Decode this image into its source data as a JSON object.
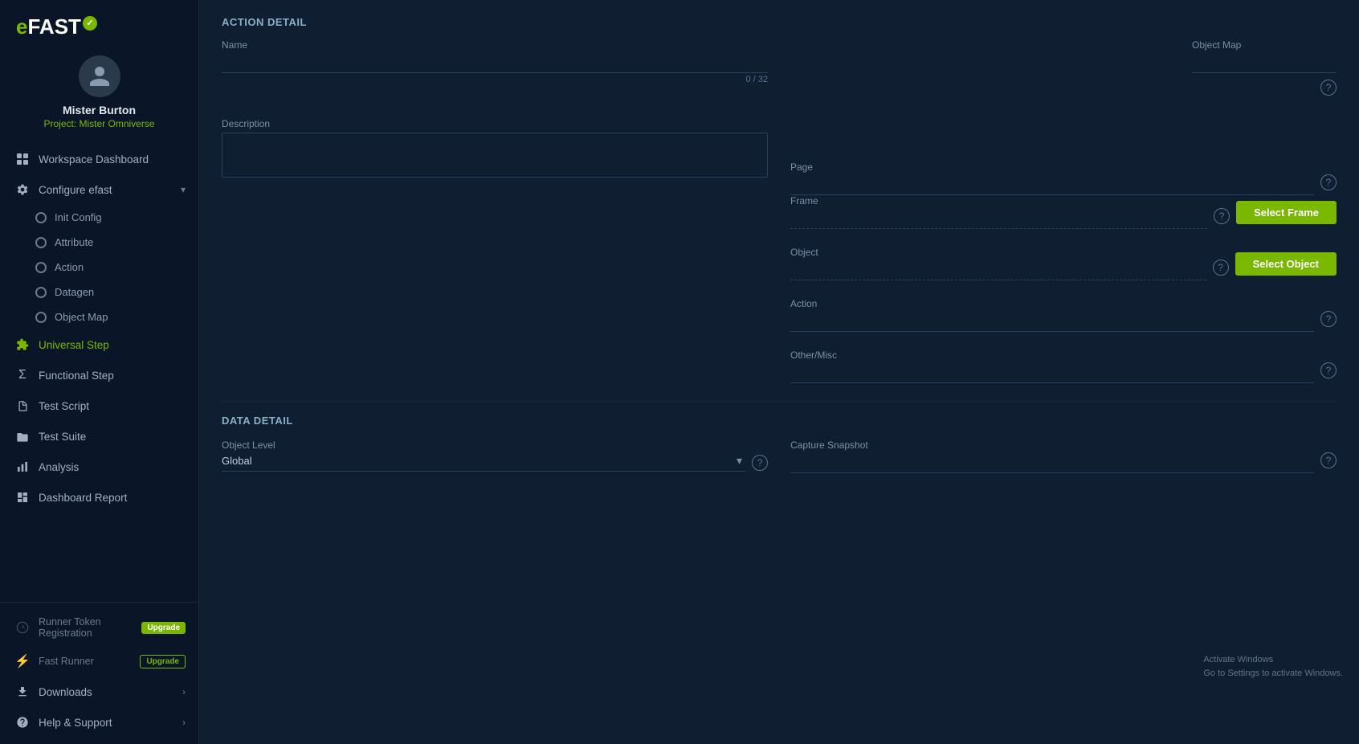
{
  "app": {
    "logo": "eFAST",
    "logo_check": "✓"
  },
  "user": {
    "name": "Mister Burton",
    "project": "Project: Mister Omniverse"
  },
  "sidebar": {
    "items": [
      {
        "id": "workspace-dashboard",
        "label": "Workspace Dashboard",
        "icon": "grid",
        "type": "main"
      },
      {
        "id": "configure-efast",
        "label": "Configure efast",
        "icon": "gear",
        "type": "expandable",
        "expanded": true
      },
      {
        "id": "init-config",
        "label": "Init Config",
        "type": "sub"
      },
      {
        "id": "attribute",
        "label": "Attribute",
        "type": "sub"
      },
      {
        "id": "action",
        "label": "Action",
        "type": "sub"
      },
      {
        "id": "datagen",
        "label": "Datagen",
        "type": "sub"
      },
      {
        "id": "object-map",
        "label": "Object Map",
        "type": "sub"
      },
      {
        "id": "universal-step",
        "label": "Universal Step",
        "icon": "puzzle",
        "type": "main",
        "active": true
      },
      {
        "id": "functional-step",
        "label": "Functional Step",
        "icon": "sigma",
        "type": "main"
      },
      {
        "id": "test-script",
        "label": "Test Script",
        "icon": "doc",
        "type": "main"
      },
      {
        "id": "test-suite",
        "label": "Test Suite",
        "icon": "folder",
        "type": "main"
      },
      {
        "id": "analysis",
        "label": "Analysis",
        "icon": "bar-chart",
        "type": "main"
      },
      {
        "id": "dashboard-report",
        "label": "Dashboard Report",
        "icon": "dashboard",
        "type": "main"
      }
    ],
    "bottom_items": [
      {
        "id": "runner-token",
        "label": "Runner Token Registration",
        "badge": "Upgrade",
        "badge_solid": true
      },
      {
        "id": "fast-runner",
        "label": "Fast Runner",
        "badge": "Upgrade",
        "badge_solid": false
      },
      {
        "id": "downloads",
        "label": "Downloads",
        "has_arrow": true
      },
      {
        "id": "help-support",
        "label": "Help & Support",
        "has_arrow": true
      }
    ]
  },
  "main": {
    "action_detail_header": "ACTION DETAIL",
    "fields": {
      "name_label": "Name",
      "name_char_count": "0 / 32",
      "description_label": "Description",
      "object_map_label": "Object Map",
      "page_label": "Page",
      "frame_label": "Frame",
      "select_frame_btn": "Select Frame",
      "object_label": "Object",
      "select_object_btn": "Select Object",
      "action_label": "Action",
      "other_misc_label": "Other/Misc"
    },
    "data_detail_header": "DATA DETAIL",
    "data_fields": {
      "object_level_label": "Object Level",
      "object_level_value": "Global",
      "capture_snapshot_label": "Capture Snapshot"
    }
  },
  "watermark": {
    "line1": "Activate Windows",
    "line2": "Go to Settings to activate Windows."
  }
}
